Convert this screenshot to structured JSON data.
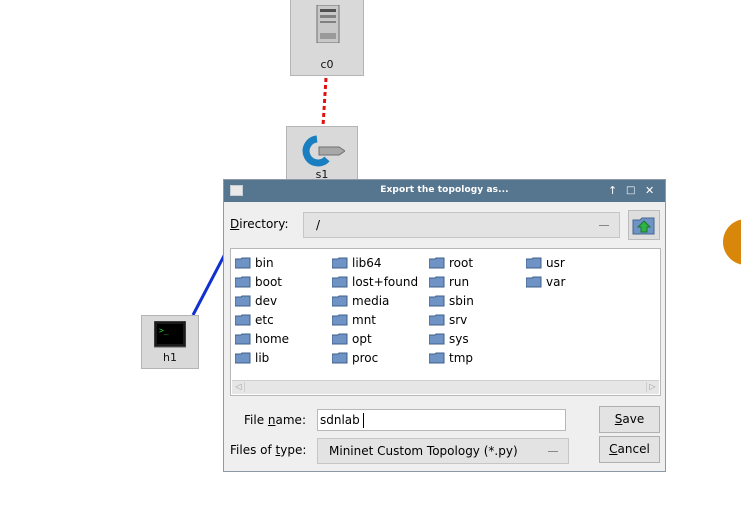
{
  "canvas": {
    "nodes": [
      {
        "id": "c0",
        "label": "c0",
        "icon": "controller-server-icon"
      },
      {
        "id": "s1",
        "label": "s1",
        "icon": "switch-arrow-icon"
      },
      {
        "id": "h1",
        "label": "h1",
        "icon": "host-terminal-icon"
      }
    ],
    "links": [
      {
        "from": "c0",
        "to": "s1",
        "style": "dashed",
        "color": "#e01010"
      },
      {
        "from": "s1",
        "to": "h1",
        "style": "solid",
        "color": "#1030d0"
      }
    ]
  },
  "dialog": {
    "title": "Export the topology as...",
    "controls": [
      "↑",
      "□",
      "✕"
    ],
    "directory": {
      "label_underlined": "D",
      "label_rest": "irectory:",
      "value": "/"
    },
    "files": [
      [
        "bin",
        "boot",
        "dev",
        "etc",
        "home",
        "lib"
      ],
      [
        "lib64",
        "lost+found",
        "media",
        "mnt",
        "opt",
        "proc"
      ],
      [
        "root",
        "run",
        "sbin",
        "srv",
        "sys",
        "tmp"
      ],
      [
        "usr",
        "var"
      ]
    ],
    "filename": {
      "label_pre": "File ",
      "label_underlined": "n",
      "label_post": "ame:",
      "value": "sdnlab"
    },
    "filetype": {
      "label_pre": "Files of ",
      "label_underlined": "t",
      "label_post": "ype:",
      "value": "Mininet Custom Topology (*.py)"
    },
    "save": {
      "underlined": "S",
      "rest": "ave"
    },
    "cancel": {
      "underlined": "C",
      "rest": "ancel"
    },
    "scroll_left": "◁",
    "scroll_right": "▷"
  },
  "colors": {
    "titlebar": "#56758f",
    "folder": "#6f93c5",
    "accent_dot": "#d9870a"
  }
}
